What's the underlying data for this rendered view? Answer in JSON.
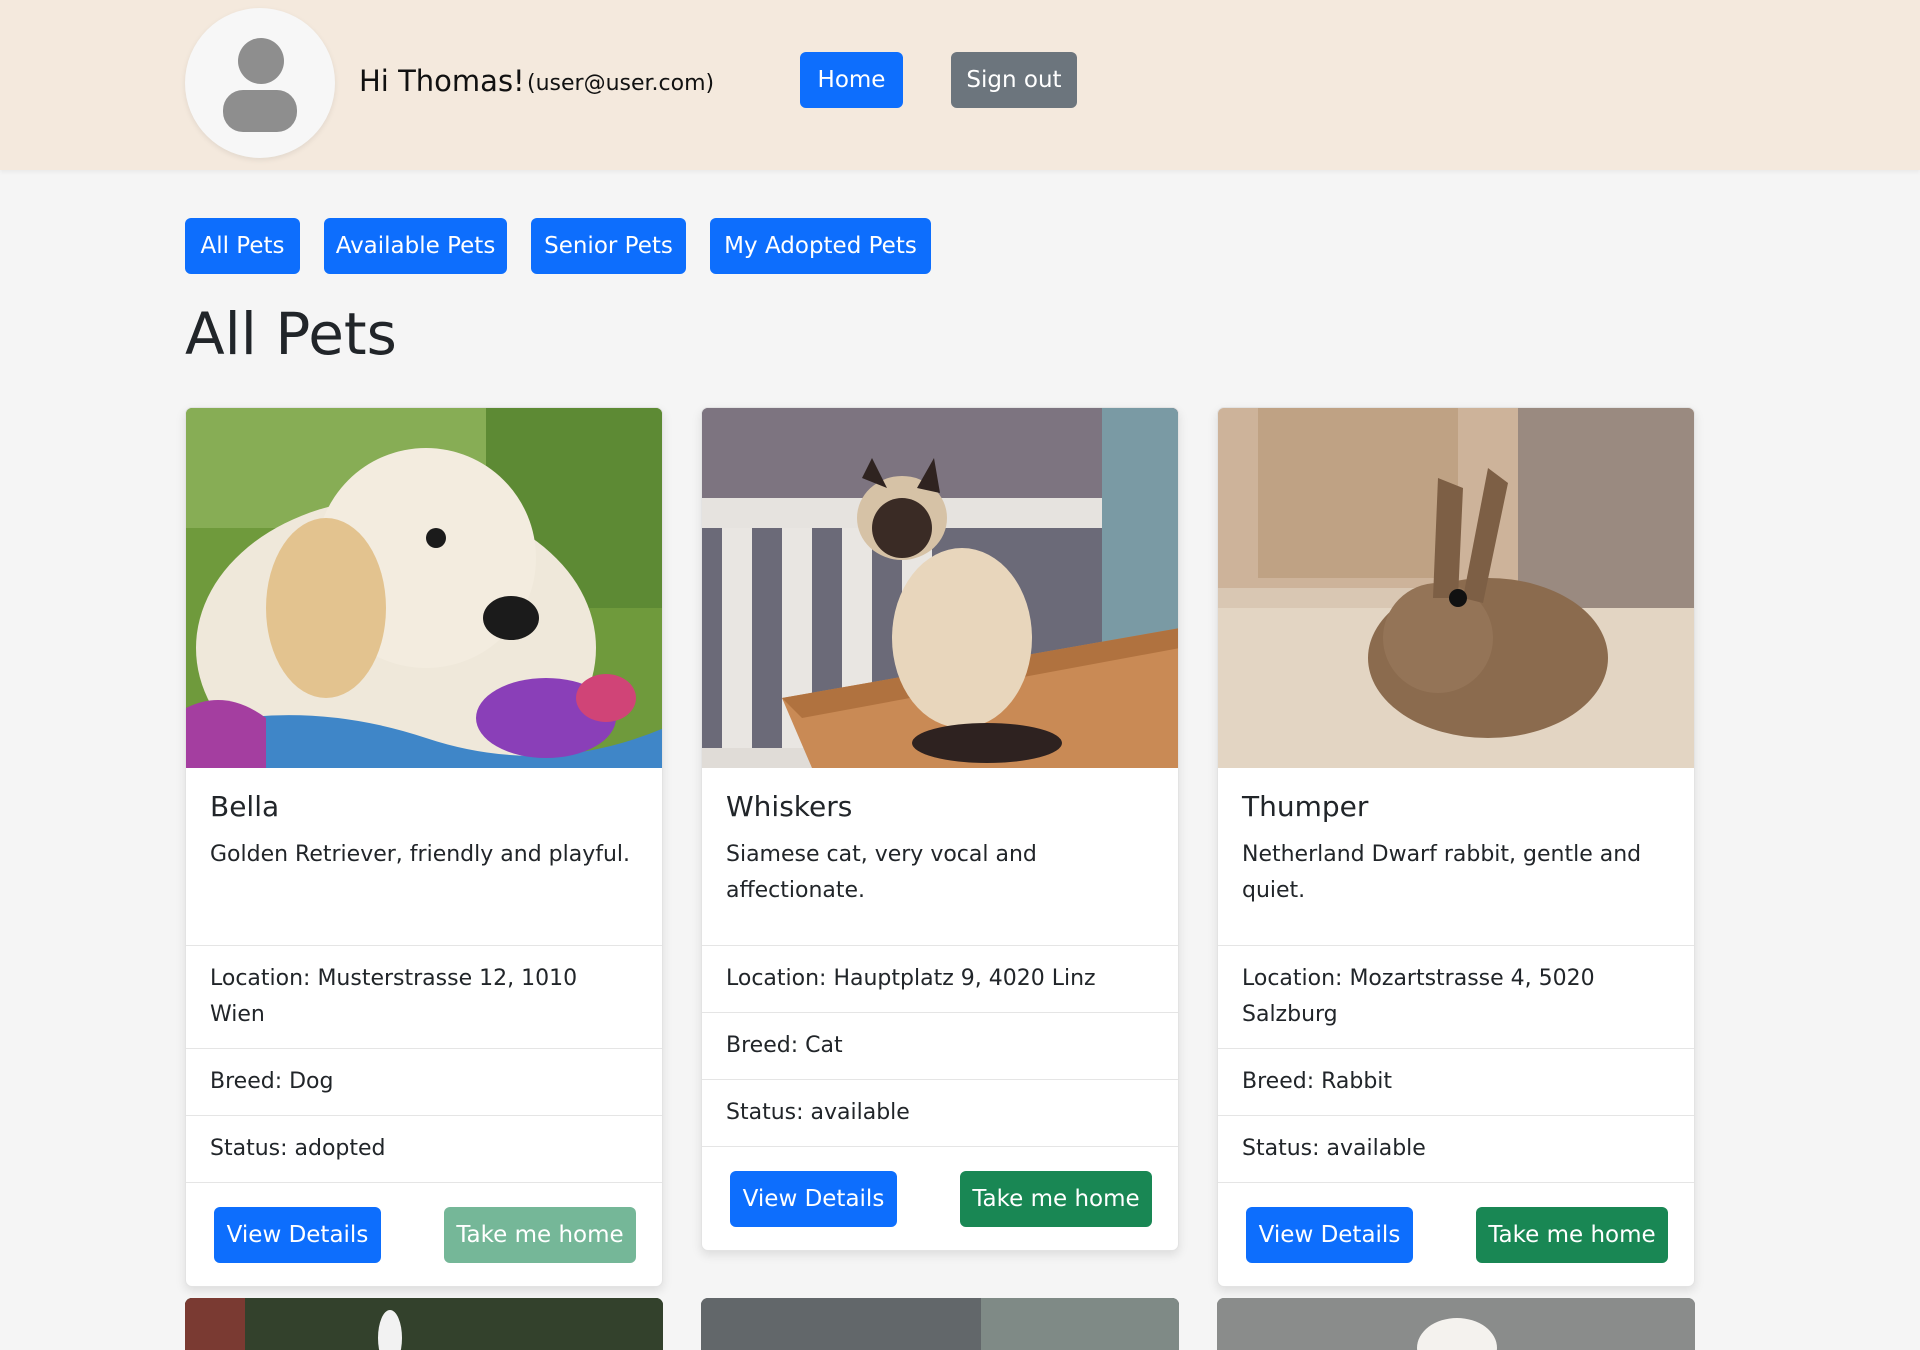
{
  "header": {
    "greeting": "Hi Thomas!",
    "email": "(user@user.com)",
    "home_label": "Home",
    "signout_label": "Sign out"
  },
  "filters": [
    "All Pets",
    "Available Pets",
    "Senior Pets",
    "My Adopted Pets"
  ],
  "page_title": "All Pets",
  "pets": [
    {
      "name": "Bella",
      "description": "Golden Retriever, friendly and playful.",
      "location": "Location: Musterstrasse 12, 1010 Wien",
      "breed": "Breed: Dog",
      "status": "Status: adopted",
      "details_label": "View Details",
      "adopt_label": "Take me home"
    },
    {
      "name": "Whiskers",
      "description": "Siamese cat, very vocal and affectionate.",
      "location": "Location: Hauptplatz 9, 4020 Linz",
      "breed": "Breed: Cat",
      "status": "Status: available",
      "details_label": "View Details",
      "adopt_label": "Take me home"
    },
    {
      "name": "Thumper",
      "description": "Netherland Dwarf rabbit, gentle and quiet.",
      "location": "Location: Mozartstrasse 4, 5020 Salzburg",
      "breed": "Breed: Rabbit",
      "status": "Status: available",
      "details_label": "View Details",
      "adopt_label": "Take me home"
    }
  ],
  "colors": {
    "primary": "#0d6efd",
    "secondary": "#6c757d",
    "success": "#198754",
    "success_disabled": "#75b798",
    "header_bg": "#f4e9dd",
    "page_bg": "#f5f5f5"
  }
}
